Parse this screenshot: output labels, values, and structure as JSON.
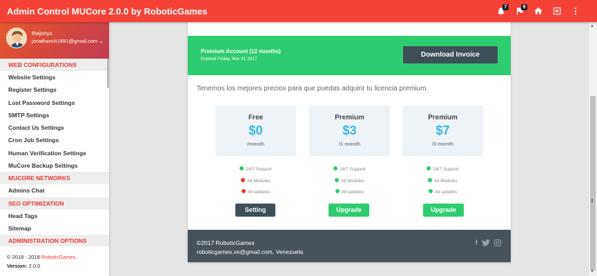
{
  "app": {
    "title": "Admin Control MUCore 2.0.0 by RoboticGames"
  },
  "topbar": {
    "actions": [
      {
        "name": "notifications-icon",
        "badge": "7"
      },
      {
        "name": "flag-icon",
        "badge": "9"
      },
      {
        "name": "home-icon",
        "badge": ""
      },
      {
        "name": "logout-icon",
        "badge": ""
      },
      {
        "name": "more-vert-icon",
        "badge": ""
      }
    ]
  },
  "user": {
    "name": "thejonyx",
    "email": "jonathanch1991@gmail.com"
  },
  "sidebar": {
    "sections": [
      {
        "header": "WEB CONFIGURATIONS",
        "items": [
          "Website Settings",
          "Register Settings",
          "Lost Password Settings",
          "SMTP Settings",
          "Contact Us Settings",
          "Cron Job Settings",
          "Human Verification Settings",
          "MuCore Backup Settings"
        ]
      },
      {
        "header": "MUCORE NETWORKS",
        "items": [
          "Admins Chat"
        ]
      },
      {
        "header": "SEO OPTIMIZATION",
        "items": [
          "Head Tags",
          "Sitemap"
        ]
      },
      {
        "header": "ADMINISTRATION OPTIONS",
        "items": []
      }
    ],
    "legal": {
      "copyright_prefix": "© 2018 - 2018 ",
      "brand": "RoboticGames.",
      "version_label": "Version:",
      "version_value": " 2.0.0"
    }
  },
  "premium": {
    "title": "Premium Account (12 months)",
    "subtitle": "Expired Friday, Mar 31 2017",
    "invoice_button": "Download Invoice"
  },
  "intro": "Tenemos los mejores precios para que puedas adquirir tu licencia premium.",
  "plans": [
    {
      "name": "Free",
      "price": "$0",
      "period": "/month",
      "features": [
        {
          "label": "24/7 Support",
          "ok": true
        },
        {
          "label": "All Modules",
          "ok": false
        },
        {
          "label": "All updates",
          "ok": false
        }
      ],
      "button": "Setting"
    },
    {
      "name": "Premium",
      "price": "$3",
      "period": "/1 month",
      "features": [
        {
          "label": "24/7 Support",
          "ok": true
        },
        {
          "label": "All Modules",
          "ok": true
        },
        {
          "label": "All updates",
          "ok": true
        }
      ],
      "button": "Upgrade"
    },
    {
      "name": "Premium",
      "price": "$7",
      "period": "/3 month",
      "features": [
        {
          "label": "24/7 Support",
          "ok": true
        },
        {
          "label": "All Modules",
          "ok": true
        },
        {
          "label": "All updates",
          "ok": true
        }
      ],
      "button": "Upgrade"
    }
  ],
  "footer": {
    "copyright": "©2017 RoboticGames",
    "contact": "roboticgames.ve@gmail.com, Venezuela",
    "social": [
      "facebook-icon",
      "twitter-icon",
      "instagram-icon"
    ]
  },
  "colors": {
    "topbar": "#f44336",
    "success": "#2ecc71",
    "accent": "#35b4e6",
    "dark": "#3f4f58",
    "danger": "#e53935"
  }
}
